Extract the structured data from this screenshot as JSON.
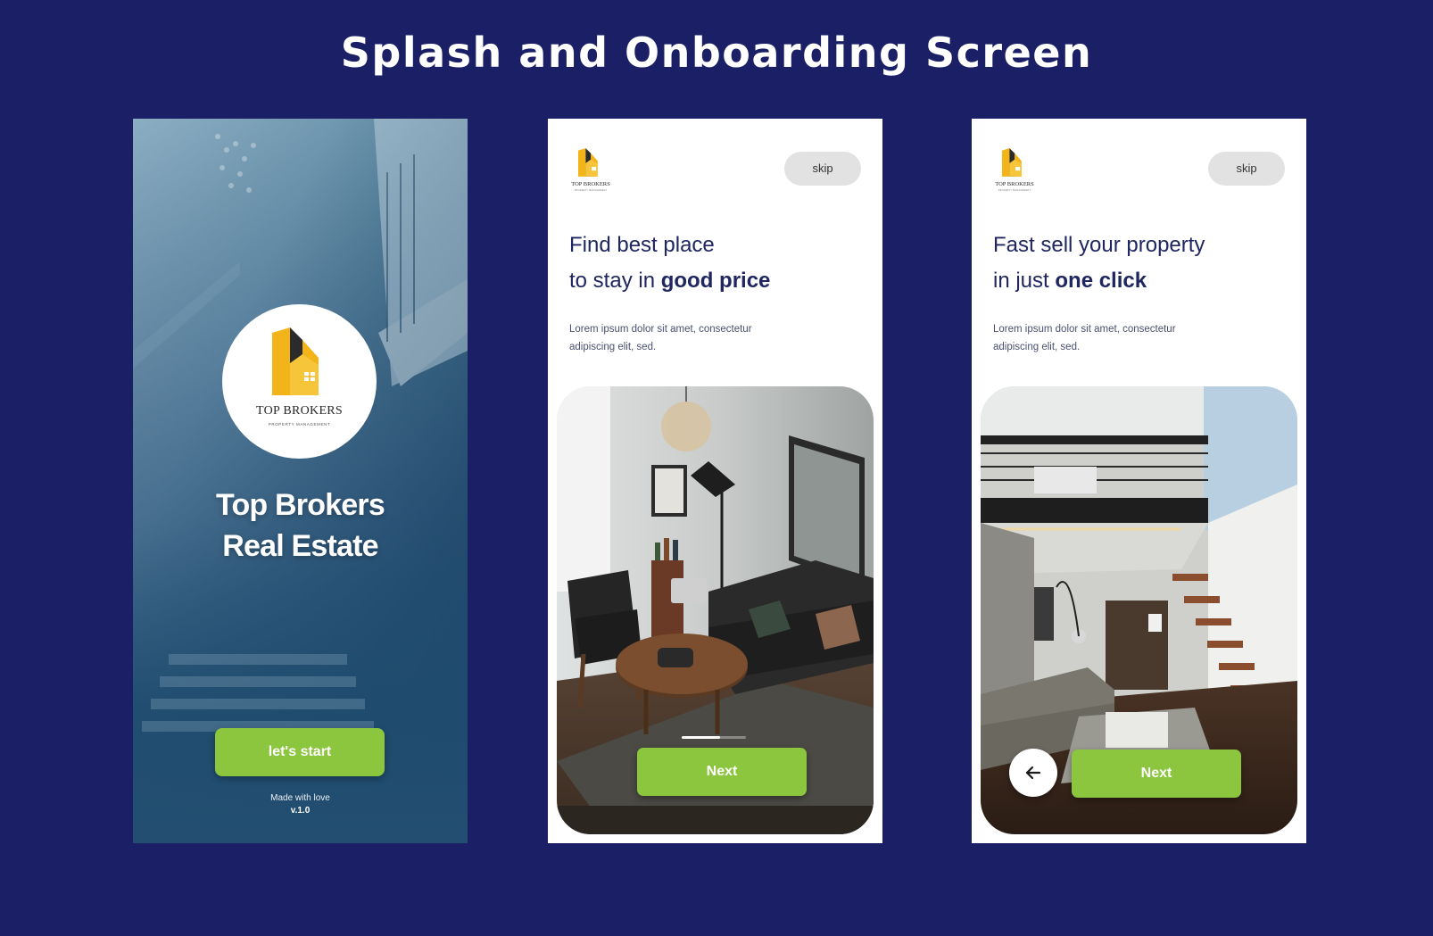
{
  "page_title": "Splash and Onboarding Screen",
  "brand": {
    "logo_name": "TOP BROKERS",
    "logo_tagline": "PROPERTY MANAGEMENT",
    "accent_color": "#8cc63f",
    "logo_yellow": "#f2b418",
    "background_color": "#1a1f66"
  },
  "splash": {
    "heading_line1": "Top Brokers",
    "heading_line2": "Real Estate",
    "start_label": "let's start",
    "footer_text": "Made with love",
    "version": "v.1.0"
  },
  "onboarding_1": {
    "skip_label": "skip",
    "title_line1": "Find best place",
    "title_line2_prefix": "to stay in ",
    "title_line2_bold": "good price",
    "description_line1": "Lorem ipsum dolor sit amet, consectetur",
    "description_line2": "adipiscing elit, sed.",
    "next_label": "Next",
    "progress": 0.6
  },
  "onboarding_2": {
    "skip_label": "skip",
    "title_line1": "Fast sell your property",
    "title_line2_prefix": "in just ",
    "title_line2_bold": "one click",
    "description_line1": "Lorem ipsum dolor sit amet, consectetur",
    "description_line2": "adipiscing elit, sed.",
    "next_label": "Next",
    "back_icon": "arrow-left-icon"
  }
}
